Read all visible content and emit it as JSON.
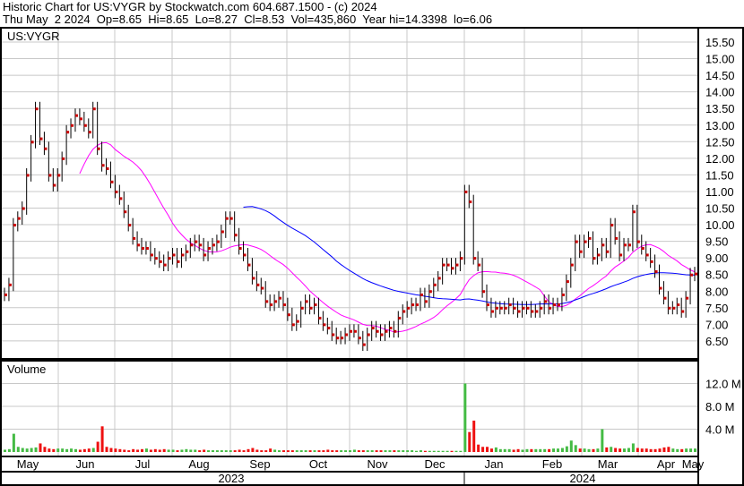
{
  "header": {
    "title": "Historic Chart for US:VYGR by Stockwatch.com 604.687.1500 - (c) 2024",
    "quote": "Thu May  2 2024  Op=8.65  Hi=8.65  Lo=8.27  Cl=8.53  Vol=435,860  Year hi=14.3398  lo=6.06"
  },
  "colors": {
    "up": "#cc0000",
    "volume_up": "#44bb44",
    "volume_down": "#ee1111",
    "ma_short": "#ff00ff",
    "ma_long": "#0000ff"
  },
  "chart_data": {
    "type": "bar",
    "title": "US:VYGR",
    "volume_label": "Volume",
    "ylim": [
      6.1,
      15.9
    ],
    "yticks": [
      "15.50",
      "15.00",
      "14.50",
      "14.00",
      "13.50",
      "13.00",
      "12.50",
      "12.00",
      "11.50",
      "11.00",
      "10.50",
      "10.00",
      "9.50",
      "9.00",
      "8.50",
      "8.00",
      "7.50",
      "7.00",
      "6.50"
    ],
    "volume_ticks": [
      "12.0 M",
      "8.0 M",
      "4.0 M"
    ],
    "volume_ylim_millions": [
      0,
      14.5
    ],
    "months": [
      "May",
      "Jun",
      "Jul",
      "Aug",
      "Sep",
      "Oct",
      "Nov",
      "Dec",
      "Jan",
      "Feb",
      "Mar",
      "Apr",
      "May"
    ],
    "years": [
      "2023",
      "2024"
    ],
    "ma_windows": [
      18,
      55
    ],
    "close": [
      7.9,
      8.2,
      10.0,
      10.2,
      10.5,
      11.5,
      12.5,
      13.5,
      12.6,
      12.3,
      11.5,
      11.2,
      11.5,
      12.0,
      12.8,
      13.0,
      13.3,
      13.2,
      13.0,
      12.8,
      13.5,
      12.3,
      11.8,
      11.7,
      11.3,
      11.0,
      10.8,
      10.4,
      10.0,
      9.6,
      9.4,
      9.3,
      9.3,
      9.1,
      9.0,
      8.9,
      8.8,
      9.0,
      9.1,
      8.9,
      9.1,
      9.2,
      9.4,
      9.5,
      9.4,
      9.1,
      9.3,
      9.4,
      9.5,
      9.8,
      10.2,
      10.2,
      9.7,
      9.3,
      9.1,
      8.8,
      8.4,
      8.2,
      8.1,
      7.7,
      7.6,
      7.7,
      7.8,
      7.6,
      7.3,
      7.0,
      7.1,
      7.5,
      7.7,
      7.5,
      7.6,
      7.2,
      7.0,
      6.9,
      6.7,
      6.6,
      6.6,
      6.7,
      6.8,
      6.8,
      6.6,
      6.4,
      6.7,
      6.9,
      6.8,
      6.7,
      6.8,
      6.9,
      6.8,
      7.2,
      7.4,
      7.5,
      7.6,
      7.6,
      7.9,
      7.7,
      8.0,
      8.2,
      8.4,
      8.8,
      8.8,
      8.7,
      8.8,
      9.0,
      11.0,
      10.7,
      9.0,
      8.8,
      8.0,
      7.6,
      7.4,
      7.5,
      7.5,
      7.5,
      7.6,
      7.5,
      7.4,
      7.5,
      7.5,
      7.4,
      7.4,
      7.5,
      7.7,
      7.5,
      7.6,
      7.6,
      7.9,
      8.3,
      8.8,
      9.5,
      9.2,
      9.5,
      9.6,
      9.0,
      9.1,
      9.4,
      9.2,
      10.0,
      9.6,
      9.1,
      9.4,
      9.4,
      10.4,
      9.5,
      9.3,
      9.1,
      8.9,
      8.6,
      8.1,
      7.8,
      7.5,
      7.5,
      7.6,
      7.4,
      7.8,
      8.5,
      8.53
    ],
    "volume_millions": [
      0.4,
      0.5,
      3.2,
      0.9,
      0.7,
      0.6,
      0.7,
      0.8,
      1.5,
      0.9,
      0.6,
      0.5,
      0.6,
      0.6,
      0.5,
      0.6,
      0.5,
      0.4,
      0.5,
      0.6,
      0.7,
      1.8,
      4.5,
      0.9,
      0.7,
      0.6,
      0.5,
      0.4,
      0.3,
      0.5,
      0.4,
      0.5,
      0.6,
      0.4,
      0.5,
      0.4,
      0.5,
      0.4,
      0.4,
      0.3,
      0.4,
      0.5,
      0.4,
      0.4,
      0.3,
      0.4,
      0.3,
      0.3,
      0.3,
      0.3,
      0.3,
      0.3,
      0.3,
      0.4,
      0.3,
      0.5,
      0.7,
      0.4,
      0.3,
      0.3,
      0.6,
      0.4,
      0.3,
      0.3,
      0.3,
      0.3,
      0.3,
      0.3,
      0.3,
      0.3,
      0.3,
      0.3,
      0.3,
      0.4,
      0.3,
      0.3,
      0.3,
      0.3,
      0.3,
      0.4,
      0.3,
      0.3,
      0.3,
      0.3,
      0.3,
      0.3,
      0.3,
      0.3,
      0.3,
      0.3,
      0.3,
      0.3,
      0.3,
      0.2,
      0.3,
      0.2,
      0.2,
      0.2,
      0.2,
      0.2,
      0.2,
      0.2,
      0.2,
      0.2,
      12.0,
      3.5,
      5.5,
      1.3,
      0.9,
      0.9,
      0.6,
      0.8,
      0.5,
      0.5,
      0.5,
      0.4,
      0.5,
      0.4,
      0.5,
      0.5,
      0.5,
      0.5,
      0.5,
      0.5,
      0.6,
      0.6,
      0.7,
      1.0,
      2.0,
      1.2,
      0.6,
      0.6,
      0.5,
      0.5,
      0.6,
      4.0,
      0.8,
      0.9,
      0.7,
      0.6,
      0.6,
      0.7,
      1.5,
      0.7,
      0.6,
      0.6,
      0.5,
      0.5,
      0.6,
      0.8,
      0.9,
      0.6,
      0.5,
      0.5,
      0.6,
      0.6,
      0.6
    ]
  }
}
